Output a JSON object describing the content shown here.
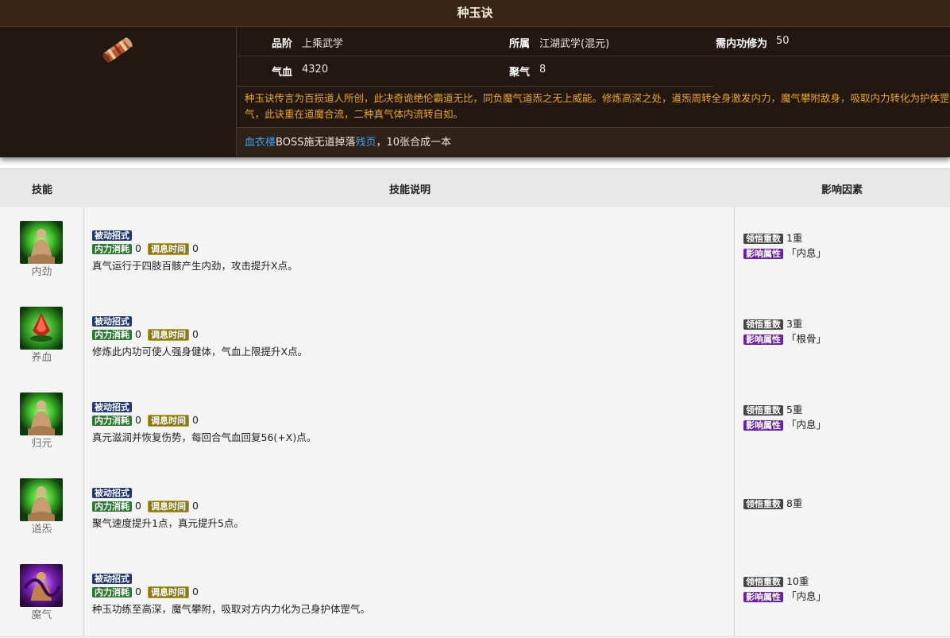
{
  "title": "种玉诀",
  "item": {
    "grade_label": "品阶",
    "grade_value": "上乘武学",
    "belong_label": "所属",
    "belong_value": "江湖武学(混元)",
    "req_label": "需内功修为",
    "req_value": "50",
    "hp_label": "气血",
    "hp_value": "4320",
    "qi_label": "聚气",
    "qi_value": "8",
    "description": "种玉诀传言为百损道人所创，此决奇诡绝伦霸道无比，同负魔气道炁之无上威能。修炼高深之处，道炁周转全身激发内力，魔气攀附敌身，吸取内力转化为护体罡气，此诀重在道魔合流，二种真气体内流转自如。",
    "drop_link1": "血衣楼",
    "drop_mid": "BOSS施无道掉落",
    "drop_link2": "残页",
    "drop_tail": "，10张合成一本"
  },
  "table": {
    "col_skill": "技能",
    "col_desc": "技能说明",
    "col_effect": "影响因素"
  },
  "tags": {
    "passive": "被动招式",
    "cost": "内力消耗",
    "cooldown": "调息时间",
    "tier": "领悟重数",
    "attr": "影响属性"
  },
  "skills": [
    {
      "name": "内劲",
      "cost": "0",
      "cooldown": "0",
      "text": "真气运行于四肢百骸产生内劲，攻击提升X点。",
      "tier": "1重",
      "attr": "「内息」",
      "icon": "green-aura-meditate-icon"
    },
    {
      "name": "养血",
      "cost": "0",
      "cooldown": "0",
      "text": "修炼此内功可使人强身健体，气血上限提升X点。",
      "tier": "3重",
      "attr": "「根骨」",
      "icon": "blood-drop-icon"
    },
    {
      "name": "归元",
      "cost": "0",
      "cooldown": "0",
      "text": "真元滋润并恢复伤势，每回合气血回复56(+X)点。",
      "tier": "5重",
      "attr": "「内息」",
      "icon": "green-aura-meditate-icon"
    },
    {
      "name": "道炁",
      "cost": "0",
      "cooldown": "0",
      "text": "聚气速度提升1点，真元提升5点。",
      "tier": "8重",
      "attr": "",
      "icon": "green-aura-meditate-icon"
    },
    {
      "name": "魔气",
      "cost": "0",
      "cooldown": "0",
      "text": "种玉功练至高深，魔气攀附，吸取对方内力化为己身护体罡气。",
      "tier": "10重",
      "attr": "「内息」",
      "icon": "purple-aura-meditate-icon"
    }
  ]
}
